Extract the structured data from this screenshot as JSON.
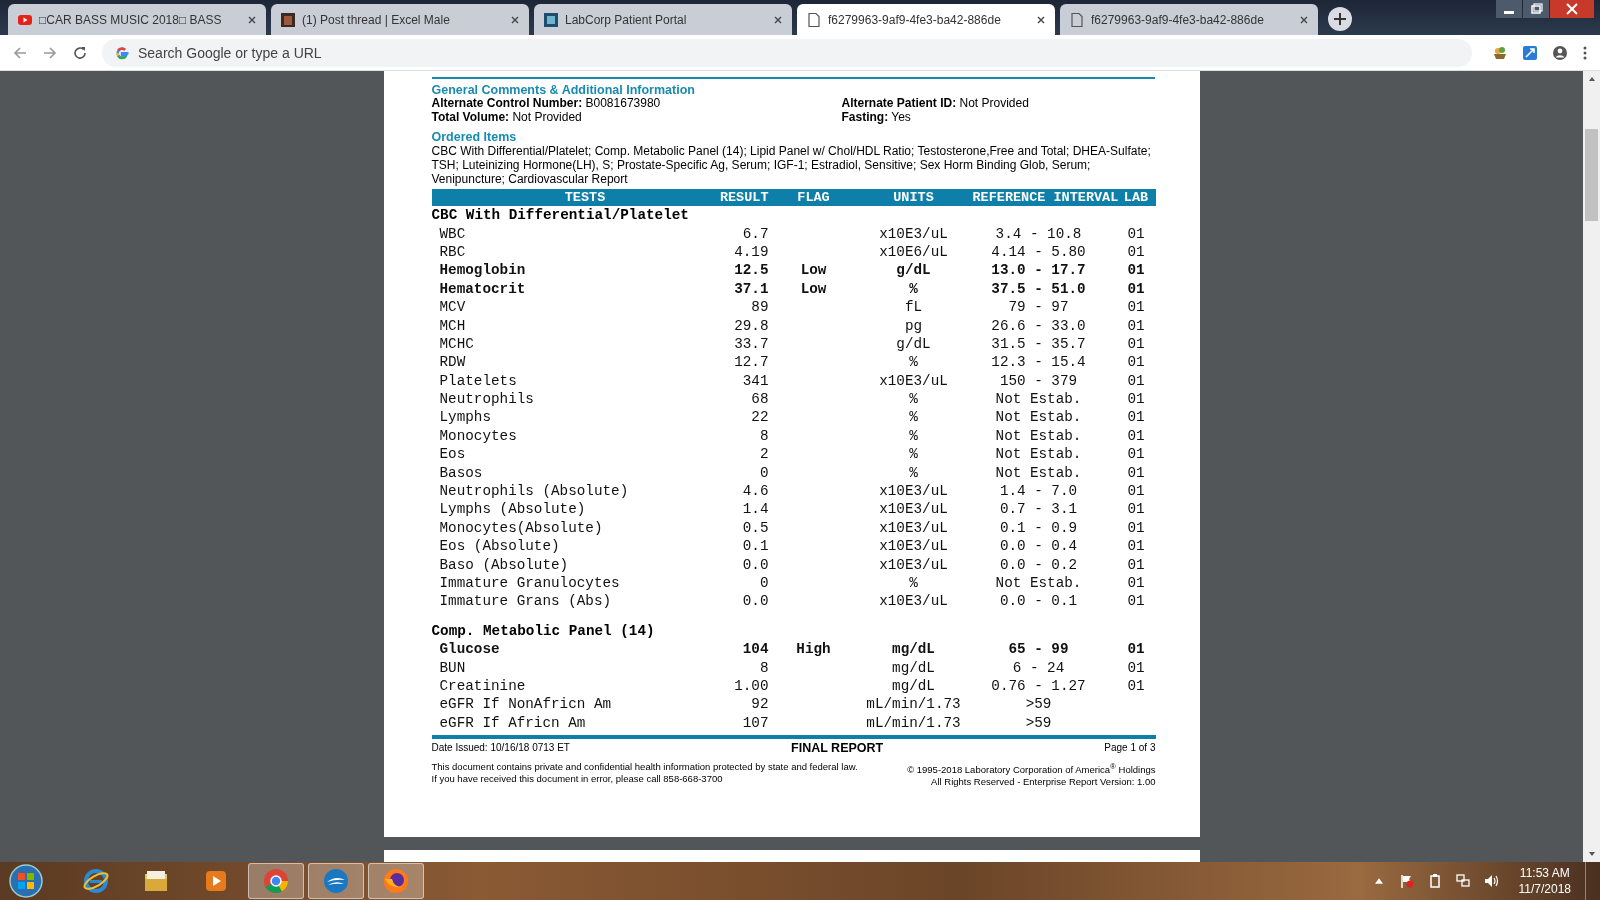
{
  "tabs": [
    {
      "title": "□CAR BASS MUSIC 2018□ BASS",
      "selected": false
    },
    {
      "title": "(1) Post thread | Excel Male",
      "selected": false
    },
    {
      "title": "LabCorp Patient Portal",
      "selected": false
    },
    {
      "title": "f6279963-9af9-4fe3-ba42-886de",
      "selected": true
    },
    {
      "title": "f6279963-9af9-4fe3-ba42-886de",
      "selected": false
    }
  ],
  "address_bar": {
    "placeholder": "Search Google or type a URL"
  },
  "report": {
    "comments_heading": "General Comments & Additional Information",
    "fields": [
      {
        "label": "Alternate Control Number:",
        "value": "B0081673980"
      },
      {
        "label": "Alternate Patient ID:",
        "value": "Not Provided"
      },
      {
        "label": "Total Volume:",
        "value": "Not Provided"
      },
      {
        "label": "Fasting:",
        "value": "Yes"
      }
    ],
    "ordered_heading": "Ordered Items",
    "ordered_text": "CBC With Differential/Platelet; Comp. Metabolic Panel (14); Lipid Panel w/ Chol/HDL Ratio; Testosterone,Free and Total; DHEA-Sulfate; TSH; Luteinizing Hormone(LH), S; Prostate-Specific Ag, Serum; IGF-1; Estradiol, Sensitive; Sex Horm Binding Glob, Serum; Venipuncture; Cardiovascular Report",
    "columns": [
      "TESTS",
      "RESULT",
      "FLAG",
      "UNITS",
      "REFERENCE",
      "INTERVAL",
      "LAB"
    ],
    "sections": [
      {
        "title": "CBC With Differential/Platelet",
        "rows": [
          {
            "test": "WBC",
            "result": "6.7",
            "units": "x10E3/uL",
            "reference": "3.4 - 10.8",
            "lab": "01",
            "flagged": false
          },
          {
            "test": "RBC",
            "result": "4.19",
            "units": "x10E6/uL",
            "reference": "4.14 - 5.80",
            "lab": "01",
            "flagged": false
          },
          {
            "test": "Hemoglobin",
            "result": "12.5",
            "flag": "Low",
            "units": "g/dL",
            "reference": "13.0 - 17.7",
            "lab": "01",
            "flagged": true
          },
          {
            "test": "Hematocrit",
            "result": "37.1",
            "flag": "Low",
            "units": "%",
            "reference": "37.5 - 51.0",
            "lab": "01",
            "flagged": true
          },
          {
            "test": "MCV",
            "result": "89",
            "units": "fL",
            "reference": "79 - 97",
            "lab": "01",
            "flagged": false
          },
          {
            "test": "MCH",
            "result": "29.8",
            "units": "pg",
            "reference": "26.6 - 33.0",
            "lab": "01",
            "flagged": false
          },
          {
            "test": "MCHC",
            "result": "33.7",
            "units": "g/dL",
            "reference": "31.5 - 35.7",
            "lab": "01",
            "flagged": false
          },
          {
            "test": "RDW",
            "result": "12.7",
            "units": "%",
            "reference": "12.3 - 15.4",
            "lab": "01",
            "flagged": false
          },
          {
            "test": "Platelets",
            "result": "341",
            "units": "x10E3/uL",
            "reference": "150 - 379",
            "lab": "01",
            "flagged": false
          },
          {
            "test": "Neutrophils",
            "result": "68",
            "units": "%",
            "reference": "Not Estab.",
            "lab": "01",
            "flagged": false
          },
          {
            "test": "Lymphs",
            "result": "22",
            "units": "%",
            "reference": "Not Estab.",
            "lab": "01",
            "flagged": false
          },
          {
            "test": "Monocytes",
            "result": "8",
            "units": "%",
            "reference": "Not Estab.",
            "lab": "01",
            "flagged": false
          },
          {
            "test": "Eos",
            "result": "2",
            "units": "%",
            "reference": "Not Estab.",
            "lab": "01",
            "flagged": false
          },
          {
            "test": "Basos",
            "result": "0",
            "units": "%",
            "reference": "Not Estab.",
            "lab": "01",
            "flagged": false
          },
          {
            "test": "Neutrophils (Absolute)",
            "result": "4.6",
            "units": "x10E3/uL",
            "reference": "1.4 - 7.0",
            "lab": "01",
            "flagged": false
          },
          {
            "test": "Lymphs (Absolute)",
            "result": "1.4",
            "units": "x10E3/uL",
            "reference": "0.7 - 3.1",
            "lab": "01",
            "flagged": false
          },
          {
            "test": "Monocytes(Absolute)",
            "result": "0.5",
            "units": "x10E3/uL",
            "reference": "0.1 - 0.9",
            "lab": "01",
            "flagged": false
          },
          {
            "test": "Eos (Absolute)",
            "result": "0.1",
            "units": "x10E3/uL",
            "reference": "0.0 - 0.4",
            "lab": "01",
            "flagged": false
          },
          {
            "test": "Baso (Absolute)",
            "result": "0.0",
            "units": "x10E3/uL",
            "reference": "0.0 - 0.2",
            "lab": "01",
            "flagged": false
          },
          {
            "test": "Immature Granulocytes",
            "result": "0",
            "units": "%",
            "reference": "Not Estab.",
            "lab": "01",
            "flagged": false
          },
          {
            "test": "Immature Grans (Abs)",
            "result": "0.0",
            "units": "x10E3/uL",
            "reference": "0.0 - 0.1",
            "lab": "01",
            "flagged": false
          }
        ]
      },
      {
        "title": "Comp. Metabolic Panel (14)",
        "rows": [
          {
            "test": "Glucose",
            "result": "104",
            "flag": "High",
            "units": "mg/dL",
            "reference": "65 - 99",
            "lab": "01",
            "flagged": true
          },
          {
            "test": "BUN",
            "result": "8",
            "units": "mg/dL",
            "reference": "6 - 24",
            "lab": "01",
            "flagged": false
          },
          {
            "test": "Creatinine",
            "result": "1.00",
            "units": "mg/dL",
            "reference": "0.76 - 1.27",
            "lab": "01",
            "flagged": false
          },
          {
            "test": "eGFR If NonAfricn Am",
            "result": "92",
            "units": "mL/min/1.73",
            "reference": ">59",
            "flagged": false
          },
          {
            "test": "eGFR If Africn Am",
            "result": "107",
            "units": "mL/min/1.73",
            "reference": ">59",
            "flagged": false
          }
        ]
      }
    ],
    "footer": {
      "date_issued": "Date Issued: 10/16/18 0713 ET",
      "status": "FINAL REPORT",
      "page": "Page 1 of 3",
      "notice": [
        "This document contains private and confidential health information protected by state and federal law.",
        "If you have received this document in error, please call 858-668-3700"
      ],
      "copyright": [
        "© 1995-2018 Laboratory Corporation of America$^{®}$ Holdings",
        "All Rights Reserved - Enterprise Report Version:  1.00"
      ]
    }
  },
  "taskbar": {
    "time": "11:53 AM",
    "date": "11/7/2018",
    "apps": [
      {
        "active": false
      },
      {
        "active": false
      },
      {
        "active": false
      },
      {
        "active": true
      },
      {
        "active": true
      },
      {
        "active": true
      }
    ]
  }
}
